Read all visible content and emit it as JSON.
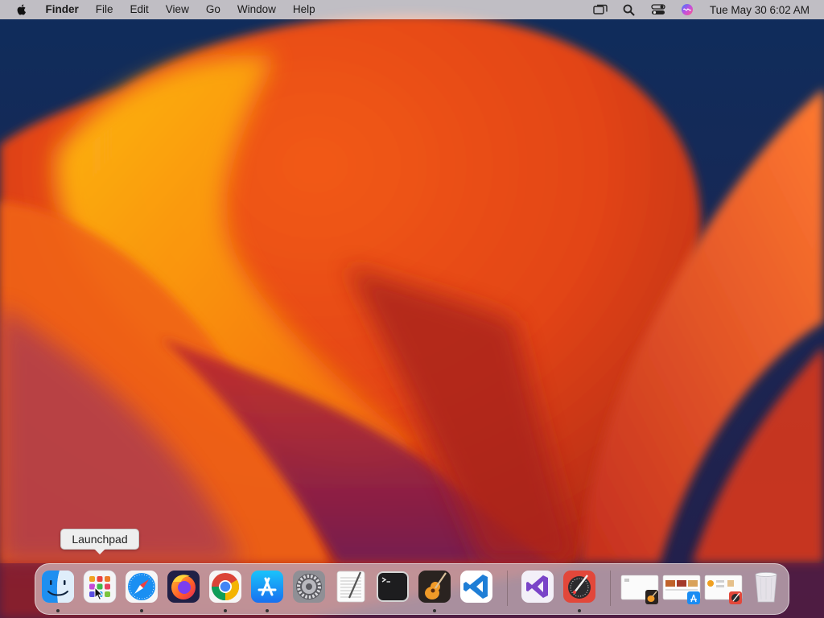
{
  "menubar": {
    "app_name": "Finder",
    "menus": [
      "File",
      "Edit",
      "View",
      "Go",
      "Window",
      "Help"
    ],
    "clock": "Tue May 30  6:02 AM",
    "status_icons": [
      "screen-mirroring-icon",
      "search-icon",
      "control-center-icon",
      "siri-icon"
    ]
  },
  "tooltip": {
    "text": "Launchpad"
  },
  "dock": {
    "items": [
      {
        "name": "finder",
        "running": true
      },
      {
        "name": "launchpad",
        "running": false
      },
      {
        "name": "safari",
        "running": true
      },
      {
        "name": "firefox",
        "running": false
      },
      {
        "name": "chrome",
        "running": true
      },
      {
        "name": "app-store",
        "running": true
      },
      {
        "name": "system-preferences",
        "running": false
      },
      {
        "name": "textedit",
        "running": false
      },
      {
        "name": "terminal",
        "running": false
      },
      {
        "name": "garageband",
        "running": true
      },
      {
        "name": "vscode",
        "running": false
      },
      {
        "name": "visual-studio",
        "running": false
      },
      {
        "name": "digital-color-meter",
        "running": true
      }
    ],
    "minimized_windows": [
      "garageband-window",
      "app-store-window",
      "color-meter-window"
    ],
    "trash": "trash"
  },
  "colors": {
    "wallpaper_bg": "#102a52",
    "wallpaper_orange": "#f05a16",
    "wallpaper_gold": "#f7a312",
    "wallpaper_magenta": "#8a1f5a"
  }
}
